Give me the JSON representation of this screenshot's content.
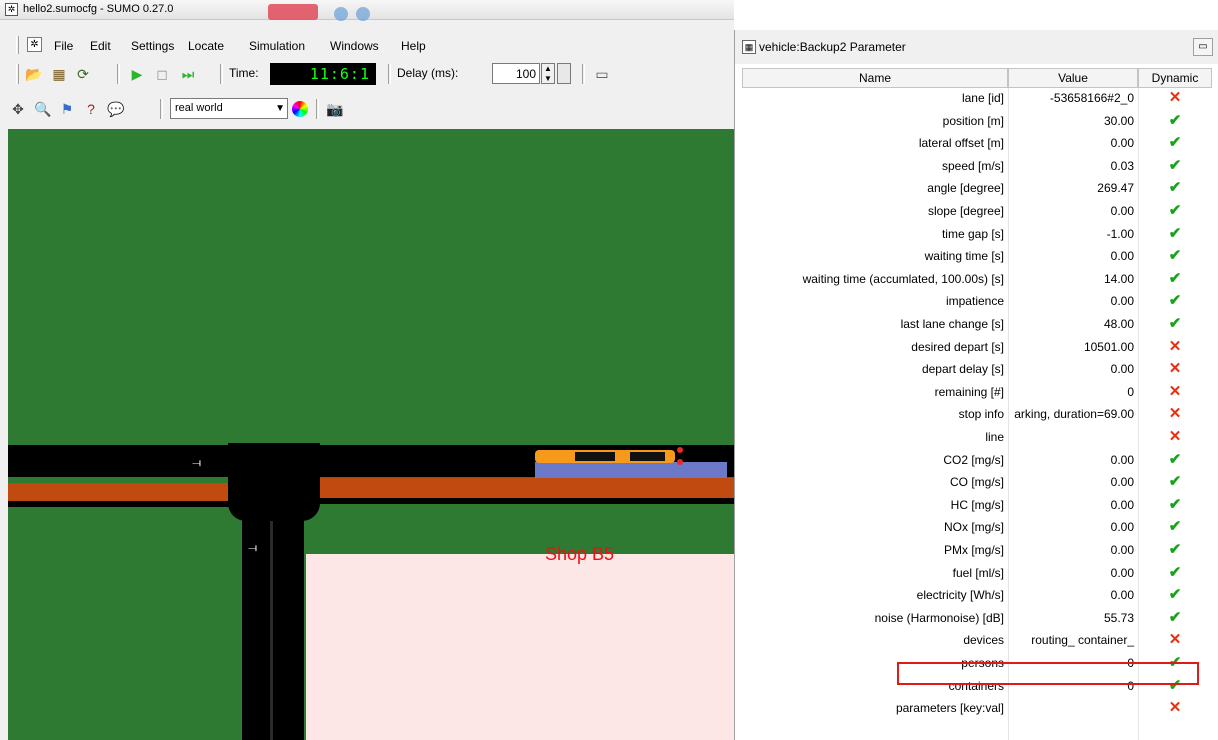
{
  "main_window": {
    "title": "hello2.sumocfg - SUMO 0.27.0",
    "menu": [
      "File",
      "Edit",
      "Settings",
      "Locate",
      "Simulation",
      "Windows",
      "Help"
    ],
    "time_label": "Time:",
    "time_value": "11:6:1",
    "delay_label": "Delay (ms):",
    "delay_value": "100",
    "view_scheme": "real world"
  },
  "map": {
    "shop_label": "Shop B5",
    "colors": {
      "grass": "#2e7a32",
      "road": "#000000",
      "rail": "#c04a10",
      "sidewalk": "#6c78c8",
      "shop": "#fde6e6",
      "vehicle": "#f79a1c"
    }
  },
  "param_window": {
    "title": "vehicle:Backup2 Parameter",
    "columns": [
      "Name",
      "Value",
      "Dynamic"
    ],
    "rows": [
      {
        "name": "lane [id]",
        "value": "-53658166#2_0",
        "dynamic": false
      },
      {
        "name": "position [m]",
        "value": "30.00",
        "dynamic": true
      },
      {
        "name": "lateral offset [m]",
        "value": "0.00",
        "dynamic": true
      },
      {
        "name": "speed [m/s]",
        "value": "0.03",
        "dynamic": true
      },
      {
        "name": "angle [degree]",
        "value": "269.47",
        "dynamic": true
      },
      {
        "name": "slope [degree]",
        "value": "0.00",
        "dynamic": true
      },
      {
        "name": "time gap [s]",
        "value": "-1.00",
        "dynamic": true
      },
      {
        "name": "waiting time [s]",
        "value": "0.00",
        "dynamic": true
      },
      {
        "name": "waiting time (accumlated, 100.00s) [s]",
        "value": "14.00",
        "dynamic": true
      },
      {
        "name": "impatience",
        "value": "0.00",
        "dynamic": true
      },
      {
        "name": "last lane change [s]",
        "value": "48.00",
        "dynamic": true
      },
      {
        "name": "desired depart [s]",
        "value": "10501.00",
        "dynamic": false
      },
      {
        "name": "depart delay [s]",
        "value": "0.00",
        "dynamic": false
      },
      {
        "name": "remaining [#]",
        "value": "0",
        "dynamic": false
      },
      {
        "name": "stop info",
        "value": "arking, duration=69.00",
        "dynamic": false
      },
      {
        "name": "line",
        "value": "",
        "dynamic": false
      },
      {
        "name": "CO2 [mg/s]",
        "value": "0.00",
        "dynamic": true
      },
      {
        "name": "CO [mg/s]",
        "value": "0.00",
        "dynamic": true
      },
      {
        "name": "HC [mg/s]",
        "value": "0.00",
        "dynamic": true
      },
      {
        "name": "NOx [mg/s]",
        "value": "0.00",
        "dynamic": true
      },
      {
        "name": "PMx [mg/s]",
        "value": "0.00",
        "dynamic": true
      },
      {
        "name": "fuel [ml/s]",
        "value": "0.00",
        "dynamic": true
      },
      {
        "name": "electricity [Wh/s]",
        "value": "0.00",
        "dynamic": true
      },
      {
        "name": "noise (Harmonoise) [dB]",
        "value": "55.73",
        "dynamic": true
      },
      {
        "name": "devices",
        "value": "routing_ container_",
        "dynamic": false
      },
      {
        "name": "persons",
        "value": "0",
        "dynamic": true
      },
      {
        "name": "containers",
        "value": "0",
        "dynamic": true
      },
      {
        "name": "parameters [key:val]",
        "value": "",
        "dynamic": false
      }
    ],
    "dynamic_yes_symbol": "✔",
    "dynamic_no_symbol": "✕",
    "colors": {
      "dynamic_yes": "#1aa31a",
      "dynamic_no": "#e83010",
      "highlight": "#e01a1a"
    }
  }
}
